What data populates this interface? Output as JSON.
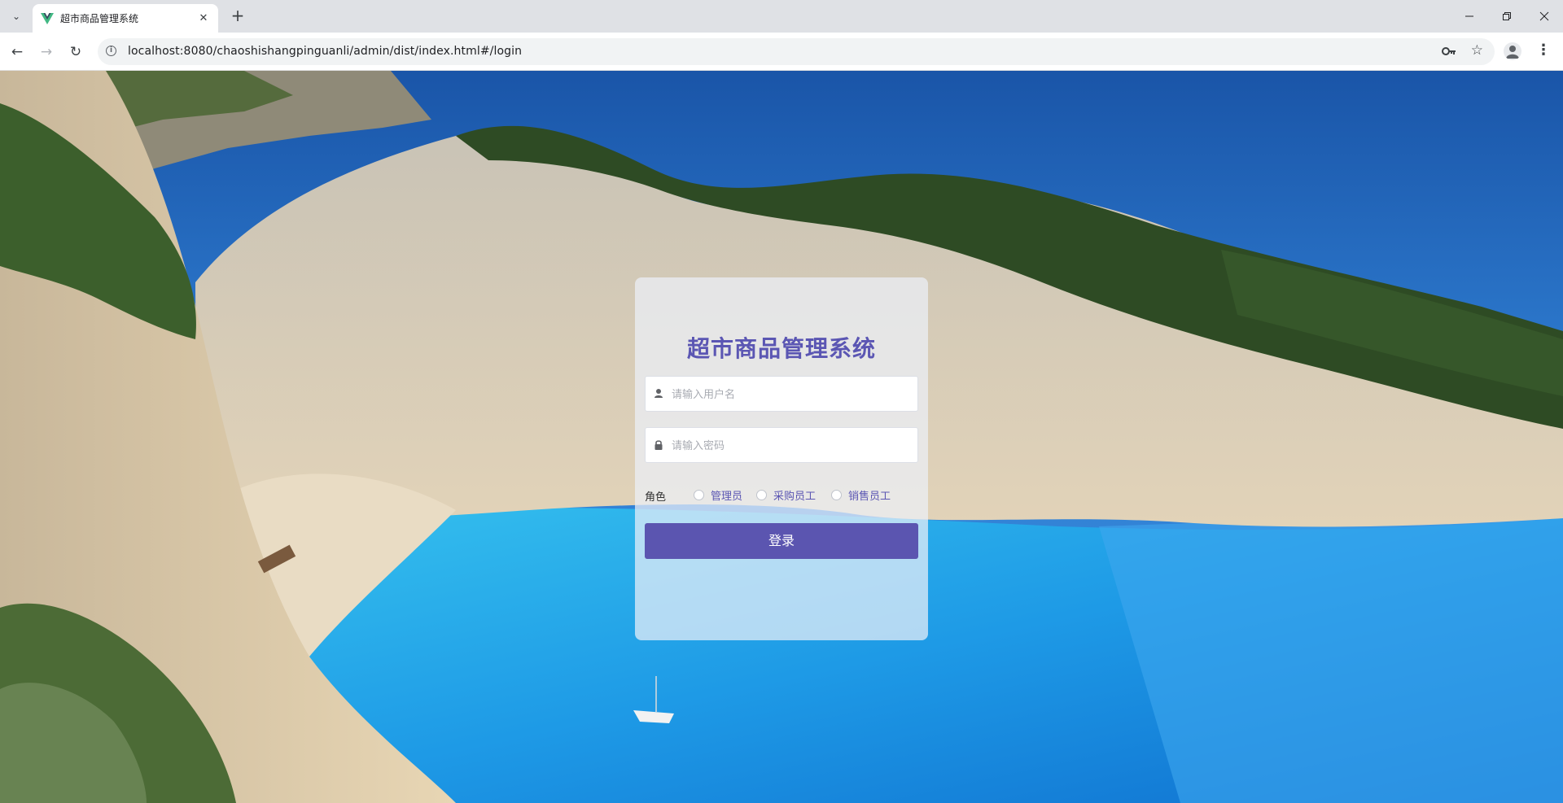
{
  "browser": {
    "tab_title": "超市商品管理系统",
    "url": "localhost:8080/chaoshishangpinguanli/admin/dist/index.html#/login",
    "icons": {
      "tab_search": "chevron-down-icon",
      "close_tab": "close-icon",
      "new_tab": "plus-icon",
      "minimize": "minimize-icon",
      "restore": "restore-icon",
      "close_window": "close-icon",
      "back": "arrow-left-icon",
      "forward": "arrow-right-icon",
      "reload": "reload-icon",
      "site_info": "info-icon",
      "password": "key-icon",
      "bookmark": "star-icon",
      "profile": "avatar-icon",
      "menu": "more-vertical-icon"
    }
  },
  "login": {
    "title": "超市商品管理系统",
    "username_placeholder": "请输入用户名",
    "password_placeholder": "请输入密码",
    "role_label": "角色",
    "roles": [
      "管理员",
      "采购员工",
      "销售员工"
    ],
    "submit_label": "登录"
  },
  "colors": {
    "accent": "#5b56b3",
    "button": "#5b55b0"
  }
}
